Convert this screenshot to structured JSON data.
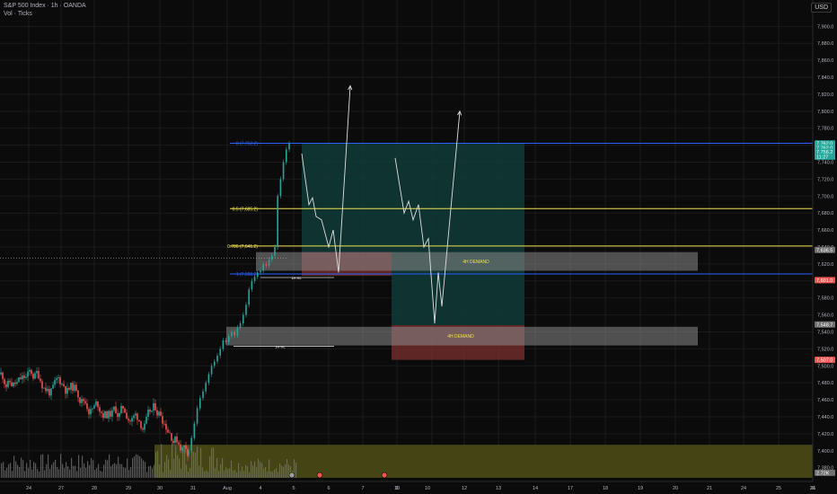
{
  "header": {
    "title": "S&P 500 Index · 1h · OANDA",
    "subtitle": "Vol · Ticks"
  },
  "currency": "USD",
  "colors": {
    "background": "#0b0b0b",
    "grid": "#1b1b1b",
    "up_candle": "#26a69a",
    "down_candle": "#ef5350",
    "fib_blue": "#2962ff",
    "fib_yellow": "#f2e24a",
    "demand_zone": "#8a8a8a",
    "profit_zone": "#0f3b37",
    "loss_zone": "#6e2b2b",
    "volume_zone": "#4a4a16",
    "projection": "#e0e0e0"
  },
  "chart_data": {
    "type": "candlestick",
    "symbol": "S&P 500 Index",
    "timeframe": "1h",
    "source": "OANDA",
    "y_axis": {
      "ticks": [
        "7,900.0",
        "7,880.0",
        "7,860.0",
        "7,840.0",
        "7,820.0",
        "7,800.0",
        "7,780.0",
        "7,760.0",
        "7,740.0",
        "7,720.0",
        "7,700.0",
        "7,680.0",
        "7,660.0",
        "7,640.0",
        "7,620.0",
        "7,600.0",
        "7,580.0",
        "7,560.0",
        "7,540.0",
        "7,520.0",
        "7,500.0",
        "7,480.0",
        "7,460.0",
        "7,440.0",
        "7,420.0",
        "7,400.0",
        "7,380.0"
      ],
      "ylim": [
        7368,
        7912
      ]
    },
    "x_axis": {
      "ticks": [
        "24",
        "27",
        "28",
        "29",
        "30",
        "31",
        "Aug",
        "4",
        "5",
        "6",
        "7",
        "8",
        "10",
        "11",
        "12",
        "13",
        "14",
        "17",
        "18",
        "19",
        "20",
        "21",
        "24",
        "25",
        "26",
        "31"
      ]
    },
    "price_badges": [
      {
        "label": "7,762.0",
        "value": 7762.0,
        "color": "#26a69a"
      },
      {
        "label": "7,762.0",
        "value": 7757.0,
        "color": "#26a69a"
      },
      {
        "label": "7,756.2",
        "value": 7752.0,
        "color": "#26a69a"
      },
      {
        "label": "11:27",
        "value": 7746.5,
        "color": "#26a69a"
      },
      {
        "label": "7,636.5",
        "value": 7636.5,
        "color": "#707070"
      },
      {
        "label": "7,601.0",
        "value": 7601.0,
        "color": "#ef5350"
      },
      {
        "label": "7,548.7",
        "value": 7548.7,
        "color": "#707070"
      },
      {
        "label": "7,507.0",
        "value": 7507.0,
        "color": "#ef5350"
      },
      {
        "label": "2.72K",
        "value": 7374.0,
        "color": "#707070"
      }
    ],
    "fib_levels": [
      {
        "label": "0 (7,762.2)",
        "value": 7762.2,
        "color": "#2962ff"
      },
      {
        "label": "0.5 (7,685.2)",
        "value": 7685.2,
        "color": "#f2e24a"
      },
      {
        "label": "0.786 (7,641.2)",
        "value": 7641.2,
        "color": "#f2e24a"
      },
      {
        "label": "1 (7,608.2)",
        "value": 7608.2,
        "color": "#2962ff"
      }
    ],
    "zones": [
      {
        "label": "4H DEMAND",
        "top": 7634,
        "bottom": 7612
      },
      {
        "label": "4H DEMAND",
        "top": 7546,
        "bottom": 7524
      }
    ],
    "markers": [
      {
        "label": "1H HL",
        "value": 7604
      },
      {
        "label": "1H HL",
        "value": 7523
      }
    ],
    "volume_zone": {
      "top": 7407,
      "bottom": 7368
    },
    "projections": [
      [
        [
          7750,
          7745
        ],
        [
          7680,
          7690
        ],
        [
          7700,
          7680
        ],
        [
          7660,
          7670
        ],
        [
          7605,
          7622
        ]
      ],
      [
        [
          7745,
          7720
        ],
        [
          7680,
          7690
        ],
        [
          7690,
          7670
        ],
        [
          7650,
          7660
        ],
        [
          7550,
          7600
        ]
      ]
    ],
    "current_price": 7627
  }
}
